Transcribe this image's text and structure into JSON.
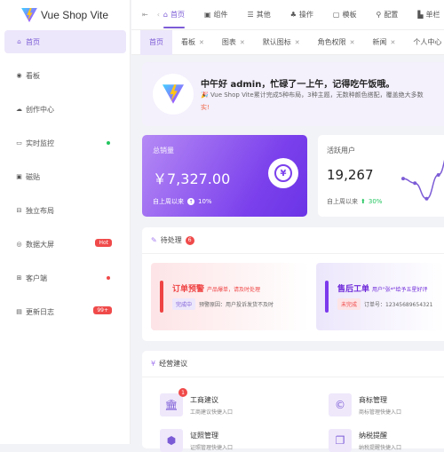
{
  "app": {
    "title": "Vue Shop Vite"
  },
  "sidebar": {
    "items": [
      {
        "label": "首页",
        "icon": "home-icon",
        "active": true
      },
      {
        "label": "看板",
        "icon": "dashboard-icon"
      },
      {
        "label": "创作中心",
        "icon": "creation-icon"
      },
      {
        "label": "实时监控",
        "icon": "camera-icon",
        "dot": "#22c55e"
      },
      {
        "label": "磁贴",
        "icon": "tile-icon"
      },
      {
        "label": "独立布局",
        "icon": "layout-icon"
      },
      {
        "label": "数据大屏",
        "icon": "screen-icon",
        "badge": "Hot"
      },
      {
        "label": "客户端",
        "icon": "apps-icon",
        "dot": "#f04a4a"
      },
      {
        "label": "更新日志",
        "icon": "log-icon",
        "badge": "99+"
      }
    ]
  },
  "topnav": {
    "items": [
      {
        "label": "首页",
        "icon": "home-icon",
        "active": true
      },
      {
        "label": "组件",
        "icon": "component-icon"
      },
      {
        "label": "其他",
        "icon": "other-icon"
      },
      {
        "label": "操作",
        "icon": "operate-icon"
      },
      {
        "label": "模板",
        "icon": "template-icon"
      },
      {
        "label": "配置",
        "icon": "config-icon"
      },
      {
        "label": "单栏",
        "icon": "column-icon"
      }
    ]
  },
  "tabs": [
    {
      "label": "首页",
      "active": true,
      "closable": false
    },
    {
      "label": "看板",
      "closable": true
    },
    {
      "label": "图表",
      "closable": true
    },
    {
      "label": "默认图标",
      "closable": true
    },
    {
      "label": "角色权限",
      "closable": true
    },
    {
      "label": "新闻",
      "closable": true
    },
    {
      "label": "个人中心",
      "closable": true
    }
  ],
  "welcome": {
    "title": "中午好 admin，忙碌了一上午，记得吃午饭哦。",
    "subtitle": "Vue Shop Vite累计完成5种布局，3种主题，无数种颜色搭配，覆盖绝大多数",
    "subtitle2": "实!"
  },
  "sales": {
    "label": "总销量",
    "value": "￥7,327.00",
    "foot": "自上周以来",
    "change": "10%"
  },
  "users": {
    "label": "活跃用户",
    "value": "19,267",
    "foot": "自上周以来",
    "change": "30%",
    "spark": [
      62,
      57,
      40,
      66,
      95
    ]
  },
  "pending": {
    "title": "待处理",
    "count": "6",
    "tasks": [
      {
        "title": "订单预警",
        "desc": "产品爆单，请及时处理",
        "tag": "完成中",
        "detail": "预警原因：用户投诉发货不及时",
        "color": "#ef4444"
      },
      {
        "title": "售后工单",
        "desc": "用户\"张*\"给予五星好评",
        "tag": "未完成",
        "detail": "订单号：12345689654321",
        "color": "#7c3aed"
      }
    ]
  },
  "suggest": {
    "title": "经营建议",
    "items": [
      {
        "name": "工商建议",
        "desc": "工商建议快捷入口",
        "icon": "bank-icon",
        "badge": "1"
      },
      {
        "name": "商标管理",
        "desc": "商标管理快捷入口",
        "icon": "copyright-icon"
      },
      {
        "name": "证照管理",
        "desc": "证照管理快捷入口",
        "icon": "license-icon"
      },
      {
        "name": "纳税提醒",
        "desc": "纳税提醒快捷入口",
        "icon": "tax-icon"
      }
    ]
  }
}
